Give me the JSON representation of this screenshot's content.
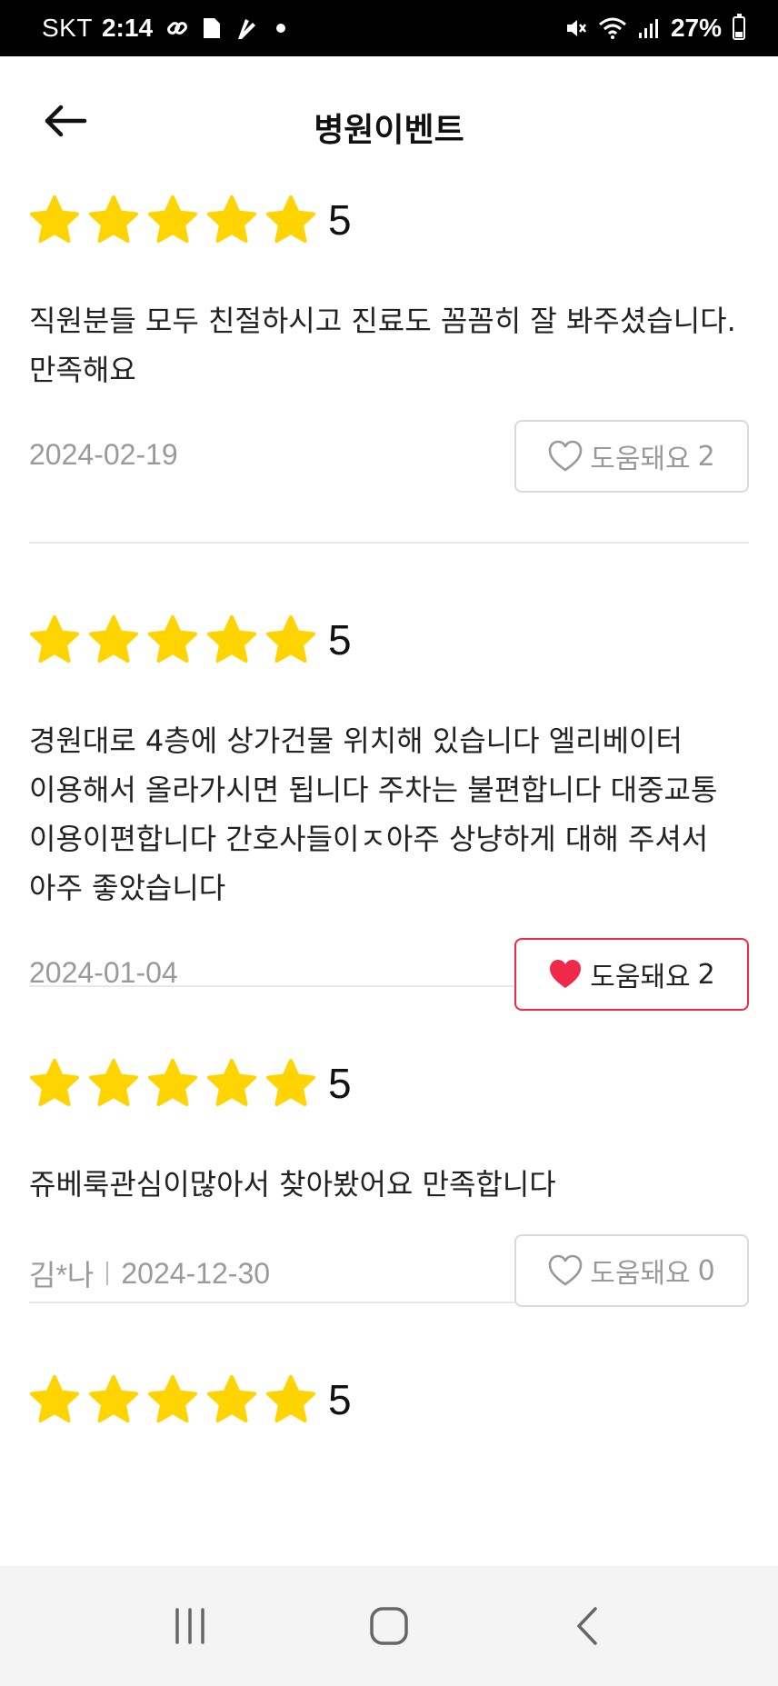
{
  "status_bar": {
    "carrier": "SKT",
    "time": "2:14",
    "battery": "27%",
    "battery_level": 0.27,
    "icons": [
      "link-icon",
      "note-icon",
      "app-icon",
      "mute-icon",
      "wifi-icon",
      "signal-icon",
      "battery-icon"
    ]
  },
  "header": {
    "title": "병원이벤트",
    "back_icon": "arrow-left-icon"
  },
  "colors": {
    "star": "#FFD400",
    "heart_active": "#F0294A",
    "border_active": "#F0294A",
    "muted_text": "#9A9A9A"
  },
  "reviews": [
    {
      "stars": 5,
      "rating": "5",
      "text": "직원분들 모두 친절하시고 진료도 꼼꼼히 잘 봐주셨습니다. 만족해요",
      "author": "",
      "date": "2024-02-19",
      "helpful_label": "도움돼요",
      "helpful_count": "2",
      "liked": false
    },
    {
      "stars": 5,
      "rating": "5",
      "text": "경원대로 4층에 상가건물 위치해 있습니다 엘리베이터 이용해서 올라가시면 됩니다 주차는 불편합니다 대중교통 이용이편합니다 간호사들이ㅈ아주 상냥하게 대해 주셔서 아주 좋았습니다",
      "author": "",
      "date": "2024-01-04",
      "helpful_label": "도움돼요",
      "helpful_count": "2",
      "liked": true
    },
    {
      "stars": 5,
      "rating": "5",
      "text": "쥬베룩관심이많아서 찾아봤어요 만족합니다",
      "author": "김*나",
      "date": "2024-12-30",
      "helpful_label": "도움돼요",
      "helpful_count": "0",
      "liked": false
    },
    {
      "stars": 5,
      "rating": "5"
    }
  ],
  "nav_bar": {
    "buttons": [
      "recent-apps-icon",
      "home-icon",
      "back-icon"
    ]
  }
}
